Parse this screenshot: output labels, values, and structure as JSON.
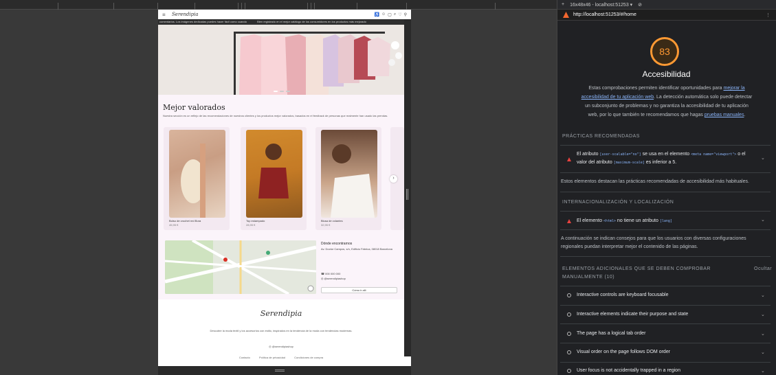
{
  "site": {
    "logo": "Serendipia",
    "marquee": [
      "comentarios. Los imágenes dedicadas puedes hacer fácil como cuando",
      "Bien registrado en el mejor catálogo de los consumidores en los productos más mejorado"
    ],
    "best": {
      "title": "Mejor valorados",
      "desc": "Nuestra sección es un reflejo de las recomendaciones de nuestros clientes y los productos mejor valorados, basados en el feedback de personas que realmente han usado las prendas.",
      "cards": [
        {
          "title": "Bolso de crochet red Bora",
          "price": "45,95 €"
        },
        {
          "title": "Top estampado",
          "price": "28,95 €"
        },
        {
          "title": "Blusa de volantes",
          "price": "32,95 €"
        }
      ]
    },
    "visit": {
      "title": "Dónde encontrarnos",
      "address": "Av. Doctor Campos, s/n, Edificio Fábrica, 08018 Barcelona",
      "phone": "000 000 000",
      "instagram": "@serendipiashop",
      "button": "Cómo ir allí"
    },
    "footer": {
      "logo": "Serendipia",
      "text": "Descubre la moda textil y los accesorios con estilo, inspirados en la tendencia de la moda con tendencias modernas.",
      "instagram": "@serendipiashop",
      "links": [
        "Contacto",
        "Política de privacidad",
        "Condiciones de compra"
      ]
    }
  },
  "devtools": {
    "top_label": "16x48x46 - localhost:51253 ▾",
    "url": "http://localhost:51253/#/home",
    "score": "83",
    "category_title": "Accesibilidad",
    "desc_prefix": "Estas comprobaciones permiten identificar oportunidades para ",
    "desc_link1": "mejorar la accesibilidad de tu aplicación web",
    "desc_mid": ". La detección automática solo puede detectar un subconjunto de problemas y no garantiza la accesibilidad de tu aplicación web, por lo que también te recomendamos que hagas ",
    "desc_link2": "pruebas manuales",
    "desc_end": ".",
    "sections": {
      "best_practices": "PRÁCTICAS RECOMENDADAS",
      "best_practices_note": "Estos elementos destacan las prácticas recomendadas de accesibilidad más habituales.",
      "i18n": "INTERNACIONALIZACIÓN Y LOCALIZACIÓN",
      "i18n_note": "A continuación se indican consejos para que los usuarios con diversas configuraciones regionales puedan interpretar mejor el contenido de las páginas.",
      "manual": "ELEMENTOS ADICIONALES QUE SE DEBEN COMPROBAR MANUALMENTE (10)",
      "hide": "Ocultar"
    },
    "audits": {
      "viewport_a": "El atributo ",
      "viewport_code1": "[user-scalable=\"no\"]",
      "viewport_b": " se usa en el elemento ",
      "viewport_code2": "<meta name=\"viewport\">",
      "viewport_c": " o el valor del atributo ",
      "viewport_code3": "[maximum-scale]",
      "viewport_d": " es inferior a 5.",
      "lang_a": "El elemento ",
      "lang_code1": "<html>",
      "lang_b": " no tiene un atributo ",
      "lang_code2": "[lang]"
    },
    "manual_items": [
      "Interactive controls are keyboard focusable",
      "Interactive elements indicate their purpose and state",
      "The page has a logical tab order",
      "Visual order on the page follows DOM order",
      "User focus is not accidentally trapped in a region"
    ],
    "colors": {
      "score": "#ff9933",
      "fail": "#e8423f",
      "link": "#8ab4f8"
    }
  }
}
